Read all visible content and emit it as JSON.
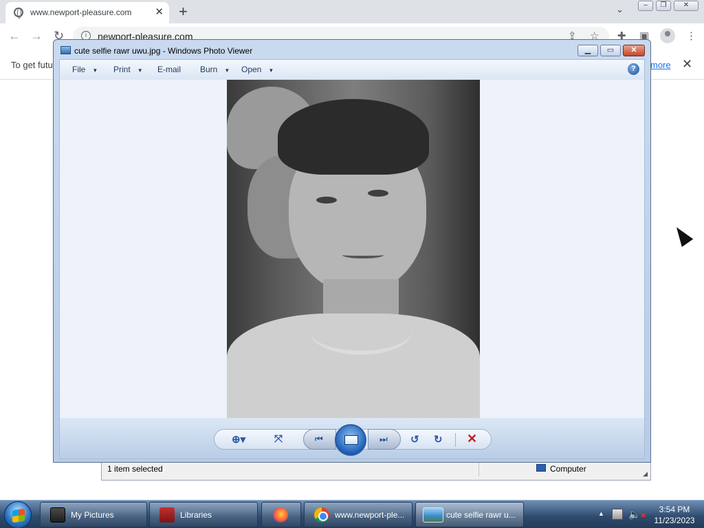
{
  "browser": {
    "tab_title": "www.newport-pleasure.com",
    "tab_close": "✕",
    "new_tab": "+",
    "tab_search": "⌄",
    "url": "newport-pleasure.com",
    "info_icon": "i",
    "infobar_text": "To get futu",
    "infobar_link": "more",
    "infobar_close": "✕"
  },
  "explorer": {
    "status_selected": "1 item selected",
    "status_location": "Computer",
    "resize_grip": "◢"
  },
  "photo_viewer": {
    "title": "cute selfie rawr uwu.jpg - Windows Photo Viewer",
    "menu": {
      "file": "File",
      "print": "Print",
      "email": "E-mail",
      "burn": "Burn",
      "open": "Open"
    },
    "help": "?",
    "dropdown_arrow": "▼",
    "controls": {
      "zoom": "⊕▾",
      "fit": "⤧",
      "previous": "⏮",
      "next": "⏭",
      "rotate_ccw": "↺",
      "rotate_cw": "↻",
      "delete": "✕"
    },
    "window_controls": {
      "minimize": "▁",
      "maximize": "▭",
      "close": "✕"
    }
  },
  "taskbar": {
    "items": [
      {
        "label": "My Pictures"
      },
      {
        "label": "Libraries"
      },
      {
        "label": ""
      },
      {
        "label": "www.newport-ple..."
      },
      {
        "label": "cute selfie rawr u..."
      }
    ],
    "clock": {
      "time": "3:54 PM",
      "date": "11/23/2023"
    },
    "tray_expand": "▲"
  },
  "colors": {
    "taskbar": "#2d4a6d",
    "viewer_frame": "#b7cce8",
    "delete": "#c11b1b"
  }
}
